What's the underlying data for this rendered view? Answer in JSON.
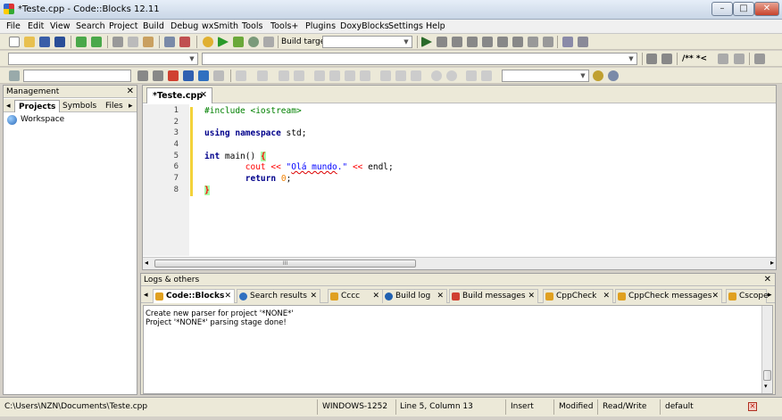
{
  "window": {
    "title": "*Teste.cpp - Code::Blocks 12.11",
    "min": "–",
    "max": "□",
    "close": "✕"
  },
  "menu": [
    "File",
    "Edit",
    "View",
    "Search",
    "Project",
    "Build",
    "Debug",
    "wxSmith",
    "Tools",
    "Tools+",
    "Plugins",
    "DoxyBlocks",
    "Settings",
    "Help"
  ],
  "toolbar": {
    "build_target_label": "Build target:",
    "comment_label": "/** *<"
  },
  "management": {
    "title": "Management",
    "close": "✕",
    "tabs": [
      "Projects",
      "Symbols",
      "Files"
    ],
    "tree": [
      "Workspace"
    ]
  },
  "editor": {
    "tab": {
      "label": "*Teste.cpp",
      "close": "✕"
    },
    "line_numbers": [
      "1",
      "2",
      "3",
      "4",
      "5",
      "6",
      "7",
      "8"
    ],
    "code": {
      "l1": "#include <iostream>",
      "l3_kw1": "using",
      "l3_kw2": "namespace",
      "l3_rest": " std;",
      "l5_kw": "int",
      "l5_rest": " main() ",
      "l5_brace": "{",
      "l6_indent": "        ",
      "l6_cout": "cout ",
      "l6_op1": "<<",
      "l6_q1": " \"",
      "l6_word": "Olá mundo",
      "l6_q2": ".\"",
      "l6_op2": "<<",
      "l6_end": " endl;",
      "l7_indent": "        ",
      "l7_kw": "return",
      "l7_num": "0",
      "l7_end": ";",
      "l8_brace": "}"
    },
    "hscroll_grip": "III"
  },
  "logs": {
    "title": "Logs & others",
    "close": "✕",
    "tabs": [
      {
        "label": "Code::Blocks",
        "color": "#e0a020"
      },
      {
        "label": "Search results",
        "color": "#3070c0"
      },
      {
        "label": "Cccc",
        "color": "#e0a020"
      },
      {
        "label": "Build log",
        "color": "#2060b0"
      },
      {
        "label": "Build messages",
        "color": "#d04030"
      },
      {
        "label": "CppCheck",
        "color": "#e0a020"
      },
      {
        "label": "CppCheck messages",
        "color": "#e0a020"
      },
      {
        "label": "Cscope",
        "color": "#e0a020"
      }
    ],
    "lines": [
      "Create new parser for project '*NONE*'",
      "Project '*NONE*' parsing stage done!"
    ]
  },
  "status": {
    "path": "C:\\Users\\NZN\\Documents\\Teste.cpp",
    "encoding": "WINDOWS-1252",
    "position": "Line 5, Column 13",
    "mode": "Insert",
    "modified": "Modified",
    "access": "Read/Write",
    "profile": "default"
  }
}
